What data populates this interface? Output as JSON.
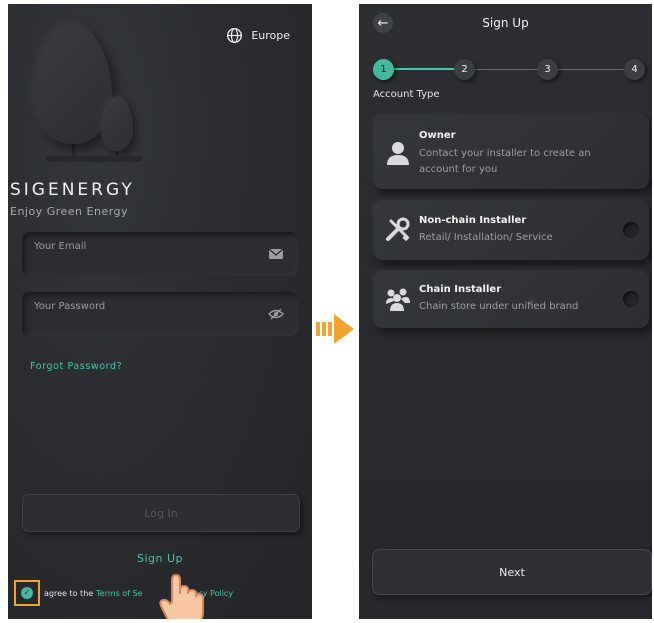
{
  "login": {
    "region_label": "Europe",
    "logo_text": "SIGENERGY",
    "tagline": "Enjoy Green Energy",
    "email_placeholder": "Your Email",
    "password_placeholder": "Your Password",
    "forgot_label": "Forgot Password?",
    "login_label": "Log In",
    "signup_label": "Sign Up",
    "terms_prefix": "agree to the",
    "terms_link": "Terms of Se",
    "privacy_link": "Privacy Policy"
  },
  "signup": {
    "title": "Sign Up",
    "steps": [
      "1",
      "2",
      "3",
      "4"
    ],
    "active_step": 1,
    "section_label": "Account Type",
    "options": [
      {
        "title": "Owner",
        "description": "Contact your installer to create an account for you",
        "icon": "person-icon"
      },
      {
        "title": "Non-chain Installer",
        "description": "Retail/ Installation/ Service",
        "icon": "tools-icon"
      },
      {
        "title": "Chain Installer",
        "description": "Chain store under unified brand",
        "icon": "group-icon"
      }
    ],
    "next_label": "Next"
  },
  "colors": {
    "accent": "#45c6b0",
    "highlight": "#f0a531",
    "background": "#2a2c30"
  }
}
